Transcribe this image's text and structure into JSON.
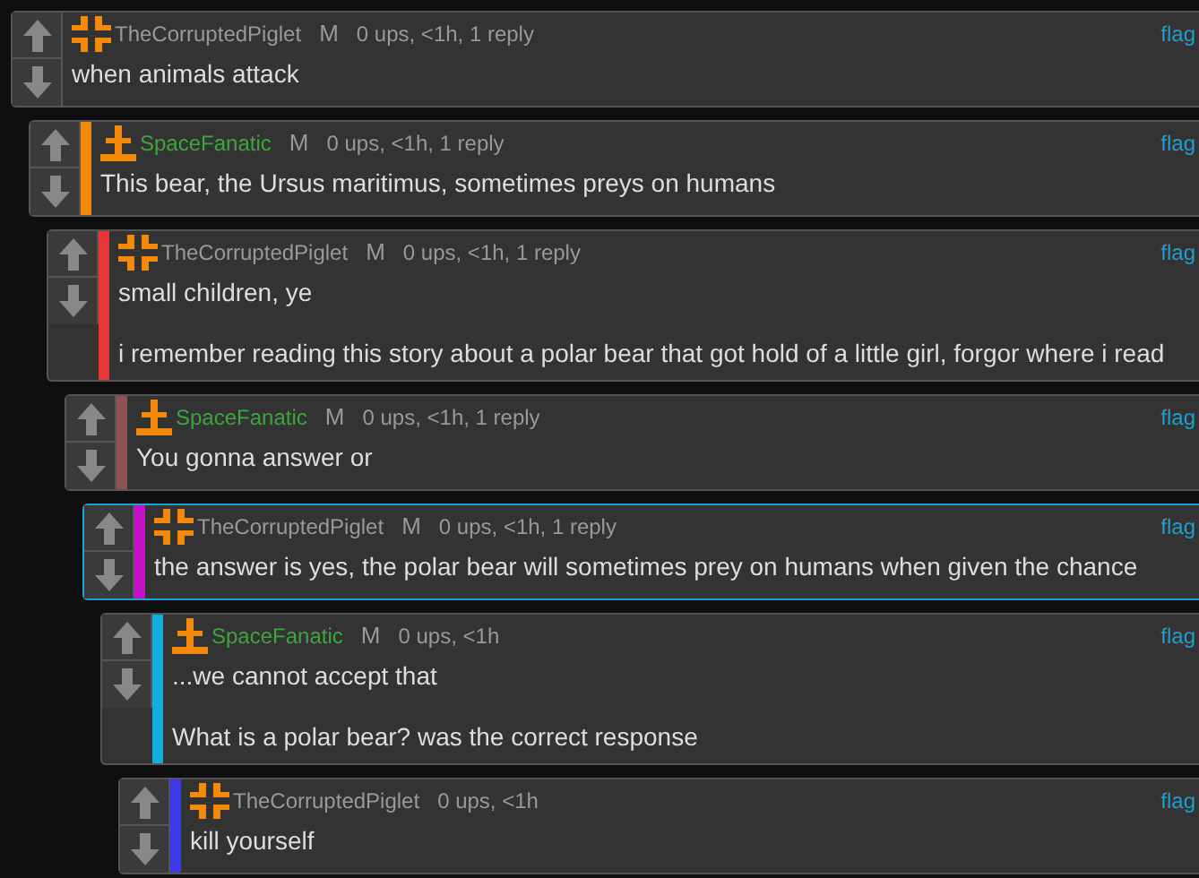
{
  "thread": [
    {
      "author": "TheCorruptedPiglet",
      "kind": "piglet",
      "mod_mark": "M",
      "meta": "0 ups, <1h, 1 reply",
      "flag": "flag",
      "highlighted": false,
      "paragraphs": [
        "when animals attack"
      ],
      "children": [
        {
          "author": "SpaceFanatic",
          "kind": "fanatic",
          "mod_mark": "M",
          "meta": "0 ups, <1h, 1 reply",
          "flag": "flag",
          "highlighted": false,
          "color": "#f58a0a",
          "paragraphs": [
            "This bear, the Ursus maritimus, sometimes preys on humans"
          ],
          "children": [
            {
              "author": "TheCorruptedPiglet",
              "kind": "piglet",
              "mod_mark": "M",
              "meta": "0 ups, <1h, 1 reply",
              "flag": "flag",
              "highlighted": false,
              "color": "#e83535",
              "paragraphs": [
                "small children, ye",
                "i remember reading this story about a polar bear that got hold of a little girl, forgor where i read"
              ],
              "children": [
                {
                  "author": "SpaceFanatic",
                  "kind": "fanatic",
                  "mod_mark": "M",
                  "meta": "0 ups, <1h, 1 reply",
                  "flag": "flag",
                  "highlighted": false,
                  "color": "#8e5252",
                  "paragraphs": [
                    "You gonna answer or"
                  ],
                  "children": [
                    {
                      "author": "TheCorruptedPiglet",
                      "kind": "piglet",
                      "mod_mark": "M",
                      "meta": "0 ups, <1h, 1 reply",
                      "flag": "flag",
                      "highlighted": true,
                      "color": "#c810c8",
                      "paragraphs": [
                        "the answer is yes, the polar bear will sometimes prey on humans when given the chance"
                      ],
                      "children": [
                        {
                          "author": "SpaceFanatic",
                          "kind": "fanatic",
                          "mod_mark": "M",
                          "meta": "0 ups, <1h",
                          "flag": "flag",
                          "highlighted": false,
                          "color": "#12aee0",
                          "paragraphs": [
                            "...we cannot accept that",
                            "What is a polar bear? was the correct response"
                          ],
                          "children": [
                            {
                              "author": "TheCorruptedPiglet",
                              "kind": "piglet",
                              "meta": "0 ups, <1h",
                              "flag": "flag",
                              "highlighted": false,
                              "color": "#3a3ae8",
                              "paragraphs": [
                                "kill yourself"
                              ]
                            }
                          ]
                        }
                      ]
                    }
                  ]
                }
              ]
            }
          ]
        }
      ]
    }
  ]
}
